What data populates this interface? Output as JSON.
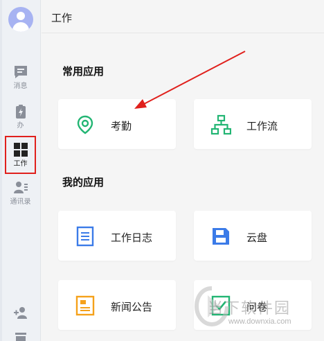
{
  "header": {
    "title": "工作"
  },
  "sidebar": {
    "items": [
      {
        "label": "消息",
        "icon": "message-icon"
      },
      {
        "label": "办",
        "icon": "task-icon"
      },
      {
        "label": "工作",
        "icon": "grid-apps-icon",
        "active": true
      },
      {
        "label": "通讯录",
        "icon": "contacts-icon"
      },
      {
        "label": "",
        "icon": "add-contact-icon"
      },
      {
        "label": "",
        "icon": "tray-icon"
      }
    ]
  },
  "sections": [
    {
      "title": "常用应用",
      "apps": [
        {
          "label": "考勤",
          "icon": "location-pin-icon",
          "color": "#22b573"
        },
        {
          "label": "工作流",
          "icon": "workflow-icon",
          "color": "#22b573"
        }
      ]
    },
    {
      "title": "我的应用",
      "apps": [
        {
          "label": "工作日志",
          "icon": "document-icon",
          "color": "#3b7be8"
        },
        {
          "label": "云盘",
          "icon": "cloud-disk-icon",
          "color": "#3b7be8"
        },
        {
          "label": "新闻公告",
          "icon": "announcement-icon",
          "color": "#f5a11a"
        },
        {
          "label": "问卷",
          "icon": "survey-icon",
          "color": "#22b573"
        }
      ]
    }
  ],
  "colors": {
    "annotation": "#e0201c",
    "accent_green": "#22b573",
    "accent_blue": "#3b7be8",
    "accent_orange": "#f5a11a"
  },
  "watermark": {
    "text": "当下软件园",
    "url": "www.downxia.com"
  }
}
